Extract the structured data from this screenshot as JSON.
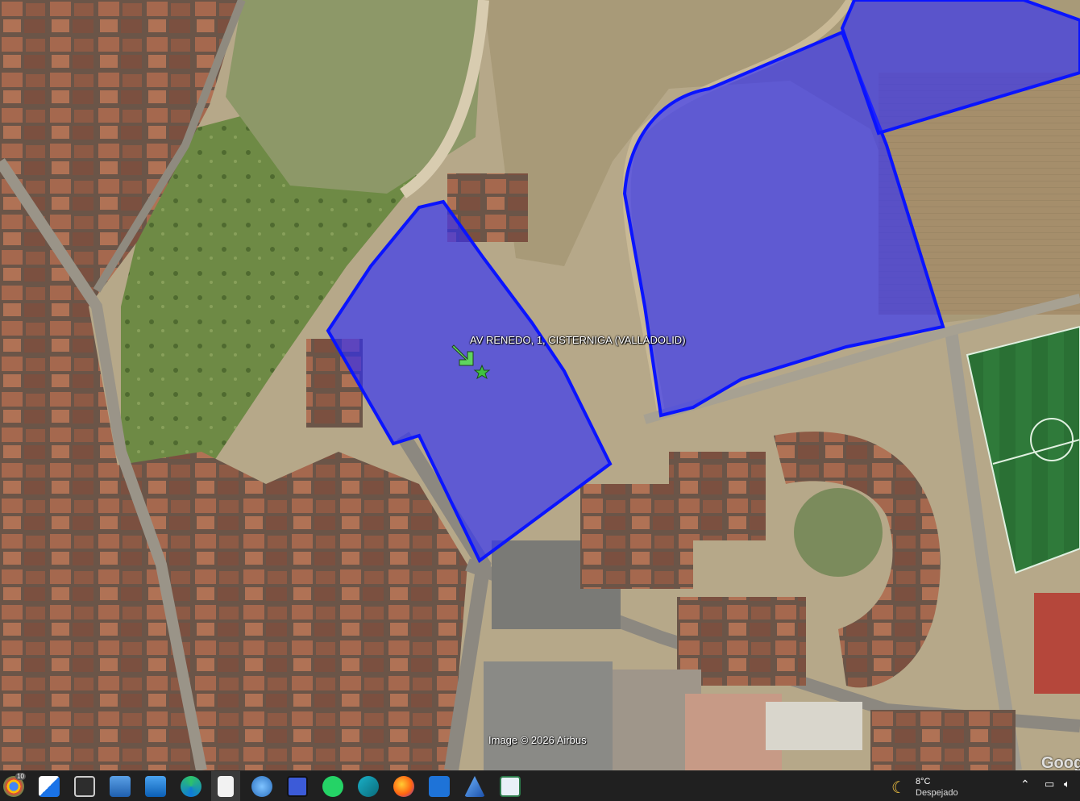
{
  "map": {
    "placemark_label": "AV RENEDO, 1, CISTERNIGA (VALLADOLID)",
    "copyright": "Image © 2026 Airbus",
    "logo_text": "Goog",
    "parcel_fill": "#2a2aff",
    "parcel_stroke": "#0a14ff",
    "placemark_arrow_color": "#5fd35f",
    "placemark_star_color": "#3fc23f"
  },
  "taskbar": {
    "icons": [
      {
        "name": "chrome-icon",
        "badge": "10"
      },
      {
        "name": "maps-app-icon"
      },
      {
        "name": "photos-icon"
      },
      {
        "name": "vpn-lock-icon"
      },
      {
        "name": "image-viewer-icon"
      },
      {
        "name": "edge-icon"
      },
      {
        "name": "document-icon"
      },
      {
        "name": "globe-icon"
      },
      {
        "name": "save-floppy-icon"
      },
      {
        "name": "whatsapp-icon"
      },
      {
        "name": "wave-app-icon"
      },
      {
        "name": "firefox-icon"
      },
      {
        "name": "s-app-icon"
      },
      {
        "name": "vector-app-icon"
      },
      {
        "name": "window-app-icon"
      }
    ],
    "weather": {
      "temperature": "8°C",
      "condition": "Despejado"
    }
  }
}
